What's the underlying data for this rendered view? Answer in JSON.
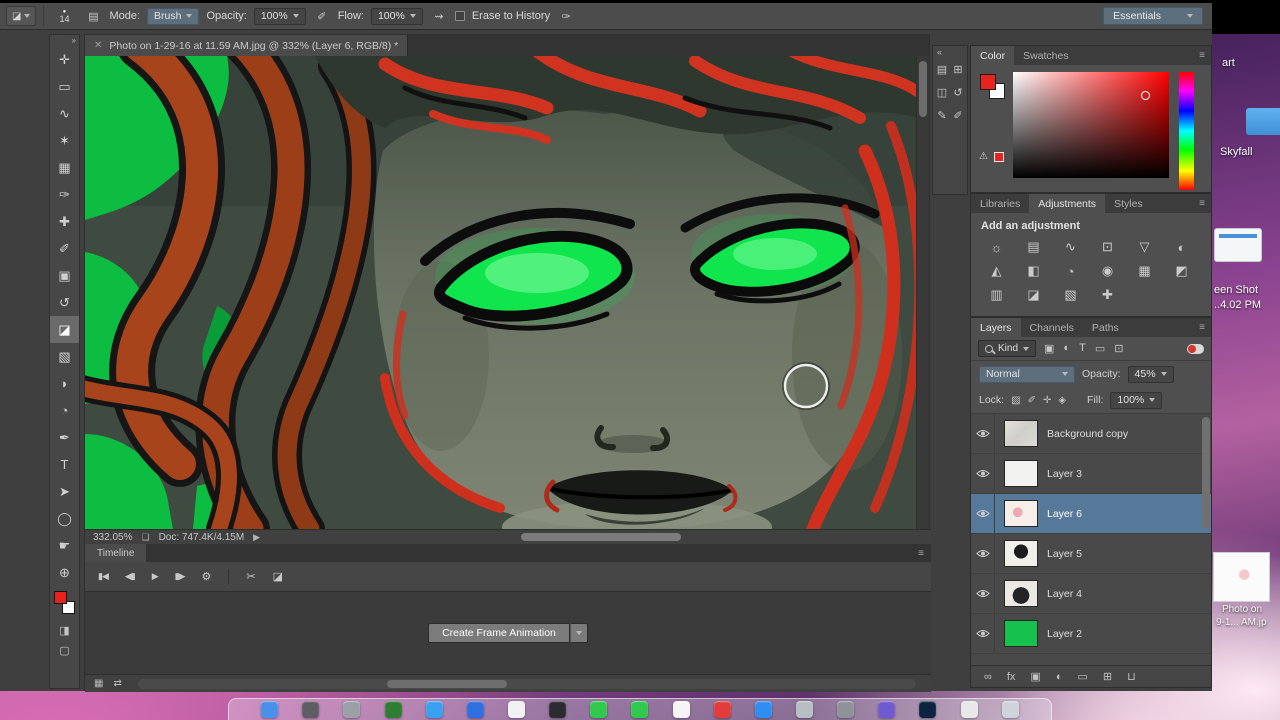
{
  "options_bar": {
    "preset_glyph": "◪",
    "brush_tip_glyph": "●",
    "brush_size": "14",
    "panel_toggle_glyph": "▤",
    "mode_label": "Mode:",
    "mode_value": "Brush",
    "opacity_label": "Opacity:",
    "opacity_value": "100%",
    "pressure_glyph": "✐",
    "flow_label": "Flow:",
    "flow_value": "100%",
    "airbrush_glyph": "⇝",
    "erase_to_history_label": "Erase to History",
    "size_pressure_glyph": "✑",
    "workspace_value": "Essentials"
  },
  "tools": {
    "header_glyph": "»",
    "quick_mask_glyph": "◨",
    "screen_mode_glyph": "▢",
    "foreground_color": "#e8221c",
    "background_color": "#ffffff",
    "items": [
      {
        "id": "move-tool",
        "glyph": "✛"
      },
      {
        "id": "rectangular-marquee-tool",
        "glyph": "▭"
      },
      {
        "id": "lasso-tool",
        "glyph": "∿"
      },
      {
        "id": "quick-selection-tool",
        "glyph": "✶"
      },
      {
        "id": "crop-tool",
        "glyph": "▦"
      },
      {
        "id": "eyedropper-tool",
        "glyph": "✑"
      },
      {
        "id": "spot-healing-brush-tool",
        "glyph": "✚"
      },
      {
        "id": "brush-tool",
        "glyph": "✐"
      },
      {
        "id": "clone-stamp-tool",
        "glyph": "▣"
      },
      {
        "id": "history-brush-tool",
        "glyph": "↺"
      },
      {
        "id": "eraser-tool",
        "glyph": "◪",
        "selected": true
      },
      {
        "id": "gradient-tool",
        "glyph": "▧"
      },
      {
        "id": "blur-tool",
        "glyph": "◗"
      },
      {
        "id": "dodge-tool",
        "glyph": "◔"
      },
      {
        "id": "pen-tool",
        "glyph": "✒"
      },
      {
        "id": "type-tool",
        "glyph": "T"
      },
      {
        "id": "path-selection-tool",
        "glyph": "➤"
      },
      {
        "id": "shape-tool",
        "glyph": "◯"
      },
      {
        "id": "hand-tool",
        "glyph": "☛"
      },
      {
        "id": "zoom-tool",
        "glyph": "⊕"
      }
    ]
  },
  "document": {
    "tab_close": "✕",
    "tab_title": "Photo on 1-29-16 at 11.59 AM.jpg @ 332% (Layer 6, RGB/8) *",
    "zoom_level": "332.05%",
    "share_glyph": "❏",
    "doc_size": "Doc: 747.4K/4.15M",
    "arrow_glyph": "▶"
  },
  "timeline": {
    "tab_label": "Timeline",
    "menu_glyph": "≡",
    "transport": [
      {
        "id": "first-frame-button",
        "glyph": "▮◀"
      },
      {
        "id": "previous-frame-button",
        "glyph": "◀▮"
      },
      {
        "id": "play-button",
        "glyph": "▶"
      },
      {
        "id": "next-frame-button",
        "glyph": "▮▶"
      }
    ],
    "gear_glyph": "⚙",
    "split_glyph": "✂",
    "transition_glyph": "◪",
    "create_button_label": "Create Frame Animation",
    "frames_glyph": "▦",
    "convert_glyph": "⇄"
  },
  "panel_dock": {
    "collapse_glyph": "«",
    "items": [
      {
        "id": "histogram-panel-icon",
        "glyph": "▤"
      },
      {
        "id": "navigator-panel-icon",
        "glyph": "⊞"
      },
      {
        "id": "info-panel-icon",
        "glyph": "◫"
      },
      {
        "id": "history-panel-icon",
        "glyph": "↺"
      },
      {
        "id": "properties-panel-icon",
        "glyph": "✎"
      },
      {
        "id": "brush-settings-panel-icon",
        "glyph": "✐"
      }
    ]
  },
  "color_panel": {
    "menu_glyph": "≡",
    "warning_glyph": "⚠",
    "foreground_color": "#e8221c",
    "background_color": "#ffffff",
    "tabs": [
      {
        "id": "tab-color",
        "label": "Color",
        "active": true
      },
      {
        "id": "tab-swatches",
        "label": "Swatches"
      }
    ]
  },
  "adjustments_panel": {
    "menu_glyph": "≡",
    "title": "Add an adjustment",
    "tabs": [
      {
        "id": "tab-libraries",
        "label": "Libraries"
      },
      {
        "id": "tab-adjustments",
        "label": "Adjustments",
        "active": true
      },
      {
        "id": "tab-styles",
        "label": "Styles"
      }
    ],
    "icons": [
      {
        "id": "adjustment-brightness-contrast-icon",
        "glyph": "☼"
      },
      {
        "id": "adjustment-levels-icon",
        "glyph": "▤"
      },
      {
        "id": "adjustment-curves-icon",
        "glyph": "∿"
      },
      {
        "id": "adjustment-exposure-icon",
        "glyph": "⊡"
      },
      {
        "id": "adjustment-vibrance-icon",
        "glyph": "▽"
      },
      {
        "id": "adjustment-hue-saturation-icon",
        "glyph": "◐"
      },
      {
        "id": "adjustment-color-balance-icon",
        "glyph": "◭"
      },
      {
        "id": "adjustment-black-white-icon",
        "glyph": "◧"
      },
      {
        "id": "adjustment-photo-filter-icon",
        "glyph": "◔"
      },
      {
        "id": "adjustment-channel-mixer-icon",
        "glyph": "◉"
      },
      {
        "id": "adjustment-color-lookup-icon",
        "glyph": "▦"
      },
      {
        "id": "adjustment-invert-icon",
        "glyph": "◩"
      },
      {
        "id": "adjustment-posterize-icon",
        "glyph": "▥"
      },
      {
        "id": "adjustment-threshold-icon",
        "glyph": "◪"
      },
      {
        "id": "adjustment-gradient-map-icon",
        "glyph": "▧"
      },
      {
        "id": "adjustment-selective-color-icon",
        "glyph": "✚"
      }
    ]
  },
  "layers_panel": {
    "menu_glyph": "≡",
    "tabs": [
      {
        "id": "tab-layers",
        "label": "Layers",
        "active": true
      },
      {
        "id": "tab-channels",
        "label": "Channels"
      },
      {
        "id": "tab-paths",
        "label": "Paths"
      }
    ],
    "filter_label": "Kind",
    "filter_icons": [
      {
        "id": "filter-pixel-layers-icon",
        "glyph": "▣"
      },
      {
        "id": "filter-adjustment-layers-icon",
        "glyph": "◐"
      },
      {
        "id": "filter-type-layers-icon",
        "glyph": "T"
      },
      {
        "id": "filter-shape-layers-icon",
        "glyph": "▭"
      },
      {
        "id": "filter-smart-objects-icon",
        "glyph": "⊡"
      }
    ],
    "blend_mode": "Normal",
    "opacity_label": "Opacity:",
    "opacity_value": "45%",
    "lock_label": "Lock:",
    "lock_icons": [
      {
        "id": "lock-transparent-icon",
        "glyph": "▨"
      },
      {
        "id": "lock-pixels-icon",
        "glyph": "✐"
      },
      {
        "id": "lock-position-icon",
        "glyph": "✛"
      },
      {
        "id": "lock-all-icon",
        "glyph": "◈"
      }
    ],
    "fill_label": "Fill:",
    "fill_value": "100%",
    "selected_color": "#567899",
    "layers": [
      {
        "id": "layer-row-background-copy",
        "name": "Background copy",
        "thumb": "linear-gradient(135deg,#e3e2de 0%,#cfcec8 50%,#dcdbd5 100%)"
      },
      {
        "id": "layer-row-layer-3",
        "name": "Layer 3",
        "thumb": "#f2f2f0"
      },
      {
        "id": "layer-row-layer-6",
        "name": "Layer 6",
        "thumb": "radial-gradient(circle at 40% 45%, #eda9b4 20%, #f6efe9 21%)",
        "selected": true
      },
      {
        "id": "layer-row-layer-5",
        "name": "Layer 5",
        "thumb": "radial-gradient(circle at 50% 42%, #1c1c1c 32%, #f0efe9 33%)"
      },
      {
        "id": "layer-row-layer-4",
        "name": "Layer 4",
        "thumb": "radial-gradient(circle at 50% 58%, #242424 38%, #ece9e2 39%)"
      },
      {
        "id": "layer-row-layer-2",
        "name": "Layer 2",
        "thumb": "#17c14e"
      }
    ],
    "bottom_icons": [
      {
        "id": "link-layers-icon",
        "glyph": "∞"
      },
      {
        "id": "layer-effects-icon",
        "glyph": "fx"
      },
      {
        "id": "add-layer-mask-icon",
        "glyph": "▣"
      },
      {
        "id": "new-adjustment-layer-icon",
        "glyph": "◐"
      },
      {
        "id": "new-group-icon",
        "glyph": "▭"
      },
      {
        "id": "new-layer-icon",
        "glyph": "⊞"
      },
      {
        "id": "delete-layer-icon",
        "glyph": "⊔"
      }
    ]
  },
  "desktop": {
    "label_art": "art",
    "label_skyfall": "Skyfall",
    "screenshot_label_line1": "een Shot",
    "screenshot_label_line2": "..4.02 PM",
    "photo_label_line1": "Photo on",
    "photo_label_line2": "9-1... AM.jp",
    "dock_icons": [
      {
        "id": "dock-finder-icon",
        "color": "#4a8fe8"
      },
      {
        "id": "dock-app-2-icon",
        "color": "#5d5d63"
      },
      {
        "id": "dock-app-3-icon",
        "color": "#9aa0a6"
      },
      {
        "id": "dock-app-4-icon",
        "color": "#2e7d32"
      },
      {
        "id": "dock-safari-icon",
        "color": "#3aa0f0"
      },
      {
        "id": "dock-mail-icon",
        "color": "#2f6fe0"
      },
      {
        "id": "dock-photos-icon",
        "color": "#f2f2f2"
      },
      {
        "id": "dock-photo-booth-icon",
        "color": "#2b2b30"
      },
      {
        "id": "dock-facetime-icon",
        "color": "#30c94e"
      },
      {
        "id": "dock-messages-icon",
        "color": "#30c94e"
      },
      {
        "id": "dock-itunes-icon",
        "color": "#f5f5f5"
      },
      {
        "id": "dock-youtube-icon",
        "color": "#e23c3c"
      },
      {
        "id": "dock-app-store-icon",
        "color": "#2f8ef0"
      },
      {
        "id": "dock-system-preferences-icon",
        "color": "#b9bec4"
      },
      {
        "id": "dock-app-15-icon",
        "color": "#8e9399"
      },
      {
        "id": "dock-app-16-icon",
        "color": "#6f5bd0"
      },
      {
        "id": "dock-photoshop-icon",
        "color": "#0d2440"
      },
      {
        "id": "dock-app-18-icon",
        "color": "#e8e8e8"
      },
      {
        "id": "dock-trash-icon",
        "color": "#cfd4da"
      }
    ]
  }
}
